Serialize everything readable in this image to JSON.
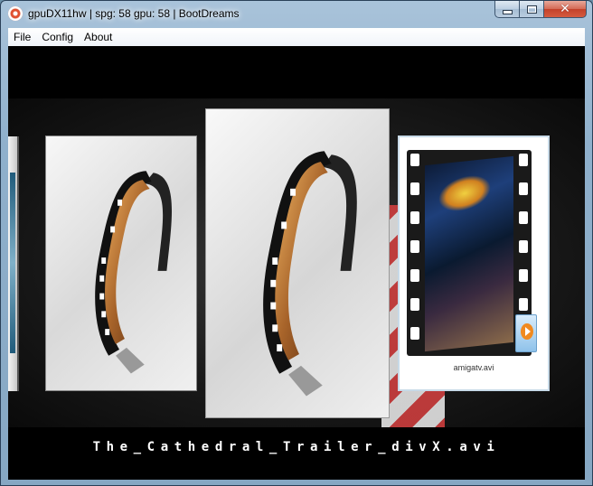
{
  "window": {
    "title": "gpuDX11hw | spg: 58 gpu: 58 | BootDreams",
    "app_icon": "bootdreams-app-icon"
  },
  "caption_buttons": {
    "minimize_icon": "minimize-icon",
    "maximize_icon": "maximize-icon",
    "close_icon": "close-icon",
    "close_glyph": "✕"
  },
  "menu": {
    "items": [
      "File",
      "Config",
      "About"
    ]
  },
  "coverflow": {
    "covers": [
      {
        "kind": "partial-edge",
        "label": ""
      },
      {
        "kind": "film-reel",
        "label": ""
      },
      {
        "kind": "film-reel",
        "label": "",
        "selected": true
      },
      {
        "kind": "video-thumbnail",
        "label": "amigatv.avi"
      }
    ],
    "play_icon": "play-icon",
    "current_title": "The_Cathedral_Trailer_divX.avi"
  },
  "colors": {
    "background": "#000000",
    "title_text": "#ffffff",
    "close_button": "#c4412a"
  }
}
